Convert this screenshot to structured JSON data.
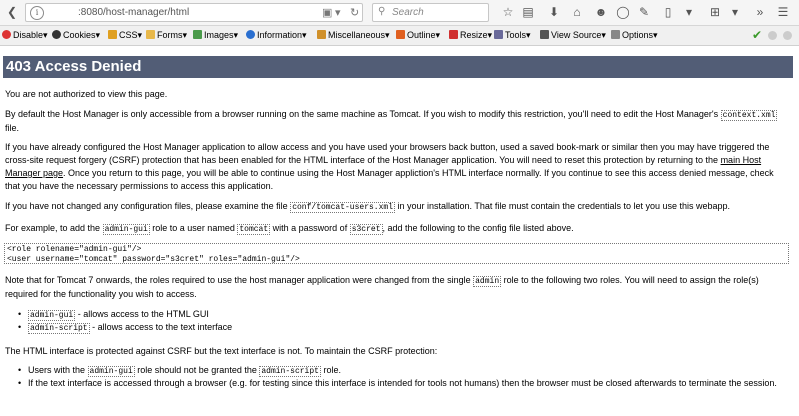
{
  "browser": {
    "url": ":8080/host-manager/html",
    "search_placeholder": "Search"
  },
  "devbar": {
    "items": [
      "Disable▾",
      "Cookies▾",
      "CSS▾",
      "Forms▾",
      "Images▾",
      "Information▾",
      "Miscellaneous▾",
      "Outline▾",
      "Resize▾",
      "Tools▾",
      "View Source▾",
      "Options▾"
    ]
  },
  "page": {
    "title": "403 Access Denied",
    "p1": "You are not authorized to view this page.",
    "p2_a": "By default the Host Manager is only accessible from a browser running on the same machine as Tomcat. If you wish to modify this restriction, you'll need to edit the Host Manager's",
    "p2_code": "context.xml",
    "p2_b": " file.",
    "p3_a": "If you have already configured the Host Manager application to allow access and you have used your browsers back button, used a saved book-mark or similar then you may have triggered the cross-site request forgery (CSRF) protection that has been enabled for the HTML interface of the Host Manager application. You will need to reset this protection by returning to the ",
    "p3_link": "main Host Manager page",
    "p3_b": ". Once you return to this page, you will be able to continue using the Host Manager appliction's HTML interface normally. If you continue to see this access denied message, check that you have the necessary permissions to access this application.",
    "p4_a": "If you have not changed any configuration files, please examine the file ",
    "p4_code": "conf/tomcat-users.xml",
    "p4_b": " in your installation. That file must contain the credentials to let you use this webapp.",
    "p5_a": "For example, to add the ",
    "p5_code1": "admin-gui",
    "p5_b": " role to a user named ",
    "p5_code2": "tomcat",
    "p5_c": " with a password of ",
    "p5_code3": "s3cret",
    "p5_d": ", add the following to the config file listed above.",
    "pre": "<role rolename=\"admin-gui\"/>\n<user username=\"tomcat\" password=\"s3cret\" roles=\"admin-gui\"/>",
    "p6_a": "Note that for Tomcat 7 onwards, the roles required to use the host manager application were changed from the single ",
    "p6_code": "admin",
    "p6_b": " role to the following two roles. You will need to assign the role(s) required for the functionality you wish to access.",
    "li1_code": "admin-gui",
    "li1_text": " - allows access to the HTML GUI",
    "li2_code": "admin-script",
    "li2_text": " - allows access to the text interface",
    "p7": "The HTML interface is protected against CSRF but the text interface is not. To maintain the CSRF protection:",
    "li3_a": "Users with the ",
    "li3_code1": "admin-gui",
    "li3_b": " role should not be granted the ",
    "li3_code2": "admin-script",
    "li3_c": " role.",
    "li4": "If the text interface is accessed through a browser (e.g. for testing since this interface is intended for tools not humans) then the browser must be closed afterwards to terminate the session."
  }
}
